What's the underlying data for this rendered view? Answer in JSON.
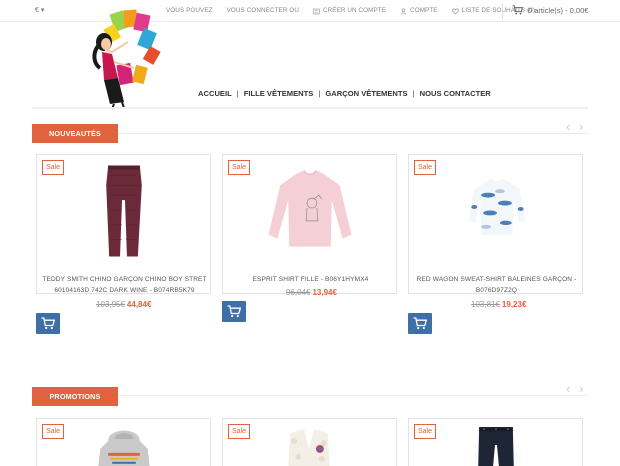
{
  "header": {
    "currency": "€ ▾",
    "links": [
      "VOUS POUVEZ",
      "VOUS CONNECTER OU",
      "CRÉER UN COMPTE",
      "COMPTE",
      "LISTE DE SOUHAITS (0)"
    ],
    "cart_label": "0 article(s) - 0,00€"
  },
  "nav": {
    "items": [
      "ACCUEIL",
      "FILLE VÊTEMENTS",
      "GARÇON VÊTEMENTS",
      "NOUS CONTACTER"
    ],
    "separator": "|"
  },
  "sections": [
    {
      "title": "NOUVEAUTÉS",
      "products": [
        {
          "badge": "Sale",
          "name_line1": "TEDDY SMITH CHINO GARÇON CHINO BOY STRET",
          "name_line2": "60104163D 742C DARK WINE - B074RB5K79",
          "old_price": "103,95€",
          "new_price": "44,84€",
          "image": "wine-chino-trousers"
        },
        {
          "badge": "Sale",
          "name_line1": "ESPRIT SHIRT FILLE - B06Y1HYMX4",
          "name_line2": "",
          "old_price": "96,04€",
          "new_price": "13,94€",
          "image": "pink-long-sleeve-shirt"
        },
        {
          "badge": "Sale",
          "name_line1": "RED WAGON SWEAT-SHIRT BALEINES GARÇON -",
          "name_line2": "B076D97Z2Q",
          "old_price": "103,81€",
          "new_price": "19,23€",
          "image": "whale-print-sweatshirt"
        }
      ]
    },
    {
      "title": "PROMOTIONS",
      "products": [
        {
          "badge": "Sale",
          "image": "grey-hoodie"
        },
        {
          "badge": "Sale",
          "image": "white-fur-vest"
        },
        {
          "badge": "Sale",
          "image": "dark-jeans"
        }
      ]
    }
  ],
  "colors": {
    "accent": "#e0623f",
    "button_blue": "#3e6fa6"
  }
}
